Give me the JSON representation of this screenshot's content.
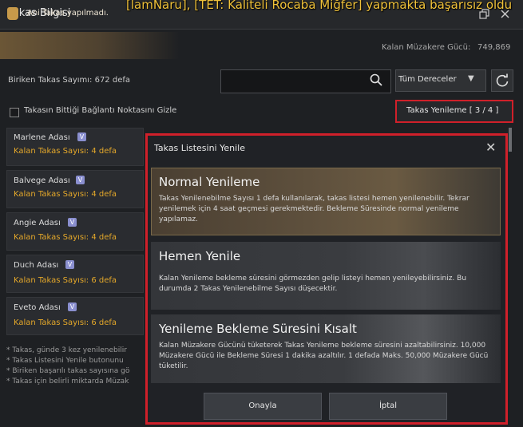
{
  "window": {
    "title": "Takas Bilgisi",
    "system_message": "[lamNaru], [TET: Kaliteli Rocaba Miğfer] yapmakta başarısız oldu"
  },
  "notice": {
    "text": "Ani Takas yapılmadı."
  },
  "power": {
    "label": "Kalan Müzakere Gücü:",
    "value": "749,869"
  },
  "count": {
    "label": "Biriken Takas Sayımı: 672 defa"
  },
  "search": {
    "placeholder": ""
  },
  "grade_filter": {
    "selected": "Tüm Dereceler"
  },
  "hide_option": {
    "label": "Takasın Bittiği Bağlantı Noktasını Gizle",
    "checked": false
  },
  "refresh_tab": {
    "label": "Takas Yenileme [ 3 / 4 ]"
  },
  "islands": [
    {
      "name": "Marlene Adası",
      "count": "Kalan Takas Sayısı: 4 defa"
    },
    {
      "name": "Balvege Adası",
      "count": "Kalan Takas Sayısı: 4 defa"
    },
    {
      "name": "Angie Adası",
      "count": "Kalan Takas Sayısı: 4 defa"
    },
    {
      "name": "Duch Adası",
      "count": "Kalan Takas Sayısı: 6 defa"
    },
    {
      "name": "Eveto Adası",
      "count": "Kalan Takas Sayısı: 6 defa"
    }
  ],
  "footnotes": [
    "* Takas, günde 3 kez yenilenebilir",
    "* Takas Listesini Yenile butonunu",
    "* Biriken başarılı takas sayısına gö",
    "* Takas için belirli miktarda Müzak"
  ],
  "modal": {
    "title": "Takas Listesini Yenile",
    "options": [
      {
        "title": "Normal Yenileme",
        "desc": "Takas Yenilenebilme Sayısı 1 defa kullanılarak, takas listesi hemen yenilenebilir. Tekrar yenilemek için 4 saat geçmesi gerekmektedir. Bekleme Süresinde normal yenileme yapılamaz."
      },
      {
        "title": "Hemen Yenile",
        "desc": "Kalan Yenileme bekleme süresini görmezden gelip listeyi hemen yenileyebilirsiniz. Bu durumda 2 Takas Yenilenebilme Sayısı düşecektir."
      },
      {
        "title": "Yenileme Bekleme Süresini Kısalt",
        "desc": "Kalan Müzakere Gücünü tüketerek Takas Yenileme bekleme süresini azaltabilirsiniz. 10,000 Müzakere Gücü ile Bekleme Süresi 1 dakika azaltılır. 1 defada Maks. 50,000 Müzakere Gücü tüketilir."
      }
    ],
    "confirm_label": "Onayla",
    "cancel_label": "İptal"
  },
  "colors": {
    "accent_red": "#d0202a",
    "gold": "#e3a72a",
    "system_yellow": "#f0c23a"
  },
  "icons": [
    "search-icon",
    "refresh-icon",
    "close-icon",
    "restore-window-icon",
    "bag-icon",
    "chevron-down-icon",
    "grade-v-icon"
  ]
}
